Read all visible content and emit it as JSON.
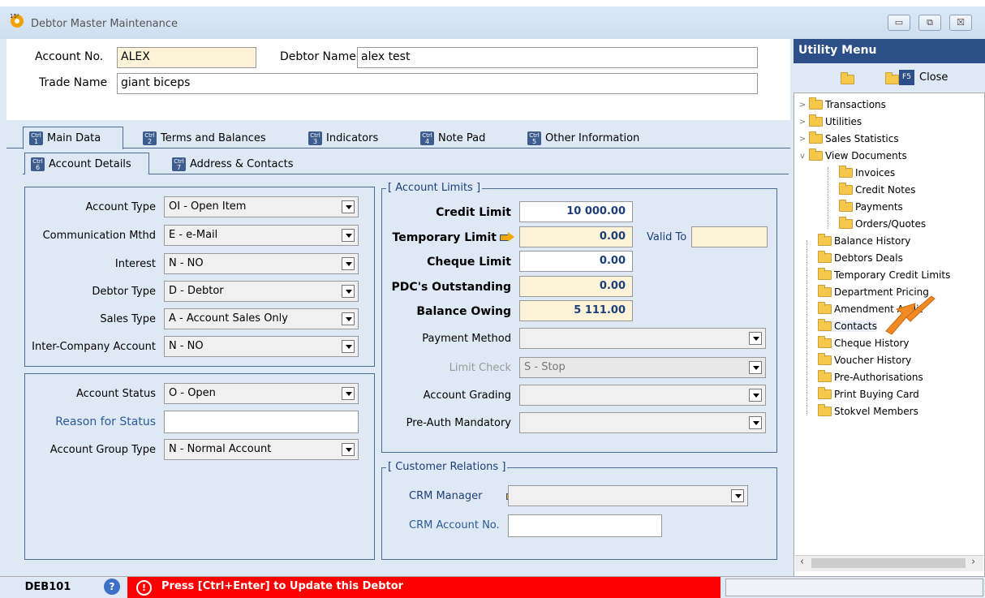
{
  "window": {
    "title": "Debtor Master Maintenance",
    "min": "▭",
    "max": "⧉",
    "close": "☒"
  },
  "header": {
    "account_no_label": "Account No.",
    "account_no": "ALEX",
    "debtor_name_label": "Debtor Name",
    "debtor_name": "alex test",
    "trade_name_label": "Trade Name",
    "trade_name": "giant biceps"
  },
  "tabs": [
    {
      "key": "1",
      "label": "Main Data"
    },
    {
      "key": "2",
      "label": "Terms and Balances"
    },
    {
      "key": "3",
      "label": "Indicators"
    },
    {
      "key": "4",
      "label": "Note Pad"
    },
    {
      "key": "5",
      "label": "Other Information"
    }
  ],
  "subtabs": [
    {
      "key": "6",
      "label": "Account Details"
    },
    {
      "key": "7",
      "label": "Address & Contacts"
    }
  ],
  "ctrl": "Ctrl",
  "account": {
    "type_label": "Account Type",
    "type": "OI - Open Item",
    "comm_label": "Communication Mthd",
    "comm": "E - e-Mail",
    "interest_label": "Interest",
    "interest": "N - NO",
    "debtor_type_label": "Debtor Type",
    "debtor_type": "D - Debtor",
    "sales_type_label": "Sales Type",
    "sales_type": "A - Account Sales Only",
    "interco_label": "Inter-Company Account",
    "interco": "N - NO"
  },
  "status": {
    "status_label": "Account Status",
    "status": "O - Open",
    "reason_label": "Reason for Status",
    "reason": "",
    "group_label": "Account Group Type",
    "group": "N - Normal Account"
  },
  "limits": {
    "legend": "[ Account Limits ]",
    "credit_label": "Credit Limit",
    "credit": "10 000.00",
    "temp_label": "Temporary Limit",
    "temp": "0.00",
    "valid_to_label": "Valid To",
    "valid_to": "",
    "cheque_label": "Cheque Limit",
    "cheque": "0.00",
    "pdc_label": "PDC's Outstanding",
    "pdc": "0.00",
    "balance_label": "Balance Owing",
    "balance": "5 111.00",
    "payment_label": "Payment Method",
    "payment": "",
    "check_label": "Limit Check",
    "check": "S - Stop",
    "grading_label": "Account Grading",
    "grading": "",
    "preauth_label": "Pre-Auth Mandatory",
    "preauth": ""
  },
  "crm": {
    "legend": "[ Customer Relations ]",
    "manager_label": "CRM Manager",
    "manager": "",
    "account_label": "CRM Account No.",
    "account": ""
  },
  "utility": {
    "title": "Utility Menu",
    "close_key": "F5",
    "close_label": "Close",
    "tree": [
      {
        "label": "Transactions"
      },
      {
        "label": "Utilities"
      },
      {
        "label": "Sales Statistics"
      },
      {
        "label": "View Documents"
      },
      {
        "label": "Invoices"
      },
      {
        "label": "Credit Notes"
      },
      {
        "label": "Payments"
      },
      {
        "label": "Orders/Quotes"
      },
      {
        "label": "Balance History"
      },
      {
        "label": "Debtors Deals"
      },
      {
        "label": "Temporary Credit Limits"
      },
      {
        "label": "Department Pricing"
      },
      {
        "label": "Amendment Audit"
      },
      {
        "label": "Contacts"
      },
      {
        "label": "Cheque History"
      },
      {
        "label": "Voucher History"
      },
      {
        "label": "Pre-Authorisations"
      },
      {
        "label": "Print Buying Card"
      },
      {
        "label": "Stokvel Members"
      }
    ]
  },
  "statusbar": {
    "code": "DEB101",
    "message": "Press [Ctrl+Enter] to Update this Debtor"
  },
  "colors": {
    "accent": "#2b4f86",
    "error": "#ff0000",
    "highlight_arrow": "#f08a24"
  }
}
